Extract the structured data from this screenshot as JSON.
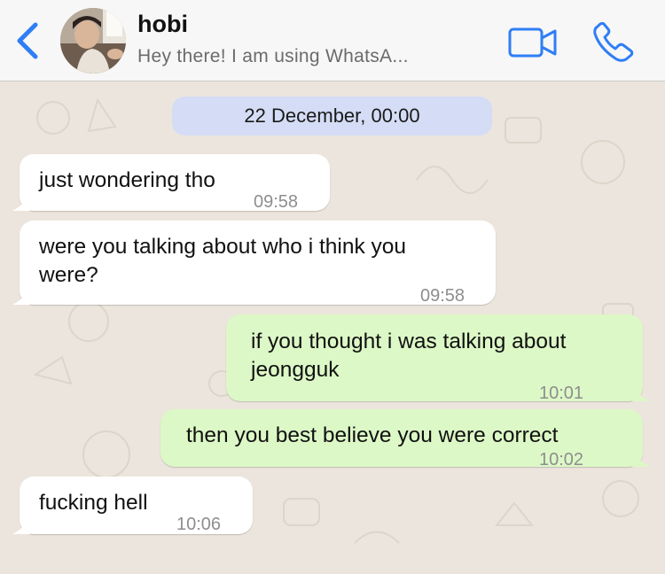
{
  "header": {
    "name": "hobi",
    "status": "Hey there! I am using WhatsA...",
    "accent_color": "#2f7ef6",
    "icons": [
      "back-chevron-icon",
      "video-camera-icon",
      "phone-icon"
    ]
  },
  "date_chip": "22 December, 00:00",
  "messages": [
    {
      "direction": "incoming",
      "lines": [
        "just wondering tho"
      ],
      "time": "09:58"
    },
    {
      "direction": "incoming",
      "lines": [
        "were you talking about who i think you",
        "were?"
      ],
      "time": "09:58"
    },
    {
      "direction": "outgoing",
      "lines": [
        "if you thought i was talking about",
        "jeongguk"
      ],
      "time": "10:01"
    },
    {
      "direction": "outgoing",
      "lines": [
        "then you best believe you were correct"
      ],
      "time": "10:02"
    },
    {
      "direction": "incoming",
      "lines": [
        "fucking hell"
      ],
      "time": "10:06"
    }
  ]
}
